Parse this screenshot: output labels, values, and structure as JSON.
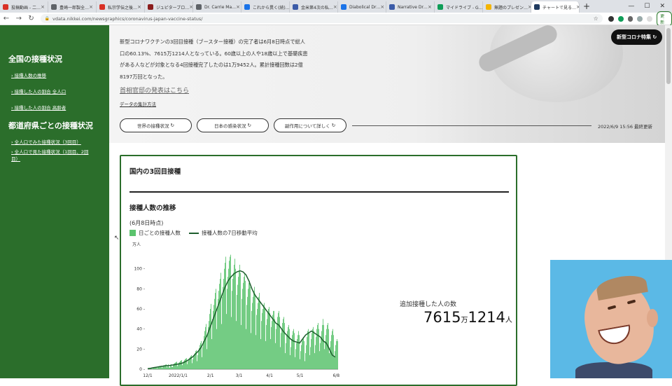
{
  "browser": {
    "tabs": [
      {
        "label": "投稿動画 - 二…",
        "color": "#d93025",
        "active": false
      },
      {
        "label": "豊崎一郎製全…",
        "color": "#5f6368",
        "active": false
      },
      {
        "label": "私宗学伝之後…",
        "color": "#d93025",
        "active": false
      },
      {
        "label": "ジュピターブロ…",
        "color": "#8a1c1c",
        "active": false
      },
      {
        "label": "Dr. Carrie Ma…",
        "color": "#5f6368",
        "active": false
      },
      {
        "label": "これから異く(続)…",
        "color": "#1a73e8",
        "active": false
      },
      {
        "label": "金米第4次の私…",
        "color": "#3b5ba8",
        "active": false
      },
      {
        "label": "Diabolical Dr…",
        "color": "#1a73e8",
        "active": false
      },
      {
        "label": "Narrative Dr…",
        "color": "#3b5ba8",
        "active": false
      },
      {
        "label": "マイドライブ - G…",
        "color": "#0f9d58",
        "active": false
      },
      {
        "label": "無題のプレゼン…",
        "color": "#f4b400",
        "active": false
      },
      {
        "label": "チャートで見る…",
        "color": "#1f3a5f",
        "active": true
      }
    ],
    "url": "vdata.nikkei.com/newsgraphics/coronavirus-japan-vaccine-status/",
    "update_label": "更新"
  },
  "sidebar": {
    "section1_title": "全国の接種状況",
    "section1_links": [
      "接種人数の推移",
      "接種した人の割合 全人口",
      "接種した人の割合 高齢者"
    ],
    "section2_title": "都道府県ごとの接種状況",
    "section2_links": [
      "全人口でみた接種状況（3回目）",
      "全人口で見た接種状況（1回目、2回目）"
    ]
  },
  "hero": {
    "intro": "新型コロナワクチンの3回目接種（ブースター接種）の完了者は6月8日時点で総人口の60.13%、7615万1214人となっている。60歳以上の人や18歳以上で基礎疾患がある人などが対象となる4回接種完了したのは1万9452人。累計接種回数は2億8197万回となった。",
    "kantei_link": "首相官邸の発表はこちら",
    "method_link": "データの集計方法",
    "buttons": [
      "世界の接種状況",
      "日本の感染状況",
      "副作用について詳しく"
    ],
    "updated": "2022/6/9 15:56 最終更新",
    "badge": "新型コロナ特集"
  },
  "card": {
    "title": "国内の3回目接種",
    "subtitle": "接種人数の推移",
    "as_of": "(6月8日時点)",
    "legend_daily": "日ごとの接種人数",
    "legend_avg": "接種人数の7日移動平均",
    "total_label": "追加接種した人の数",
    "total_big1": "7615",
    "total_unit1": "万",
    "total_big2": "1214",
    "total_unit2": "人"
  },
  "colors": {
    "sidebar_green": "#2b6e2b",
    "bar_green": "#5cc46e",
    "avg_line": "#1e5e2e"
  },
  "chart_data": {
    "type": "bar",
    "y_unit": "万人",
    "ylim": [
      0,
      120
    ],
    "yticks": [
      0,
      20,
      40,
      60,
      80,
      100
    ],
    "xticks": [
      "12/1",
      "2022/1/1",
      "2/1",
      "3/1",
      "4/1",
      "5/1",
      "6/8"
    ],
    "series": [
      {
        "name": "日ごとの接種人数",
        "type": "bar",
        "values": [
          0.3,
          0.5,
          0.8,
          0.6,
          1,
          1.2,
          0.4,
          1,
          1.5,
          1.8,
          1.6,
          2,
          2.2,
          0.8,
          2,
          2.5,
          3,
          2.8,
          3.2,
          3.5,
          1.2,
          3,
          3.6,
          4,
          3.8,
          4.5,
          4.8,
          1.8,
          4,
          5,
          2,
          1.5,
          4,
          5,
          2.5,
          2.2,
          4.5,
          5.5,
          6,
          6.5,
          7,
          7.5,
          3,
          5,
          6.5,
          7,
          8,
          8.5,
          9,
          4,
          6.5,
          8,
          9,
          10,
          10.5,
          11,
          5,
          8,
          10,
          11,
          12,
          13,
          14,
          6,
          10,
          13,
          15,
          16,
          18,
          19,
          8,
          14,
          18,
          21,
          24,
          26,
          28,
          12,
          22,
          28,
          33,
          38,
          42,
          45,
          20,
          35,
          42,
          48,
          55,
          60,
          65,
          30,
          50,
          58,
          64,
          70,
          76,
          80,
          40,
          62,
          70,
          78,
          85,
          90,
          96,
          45,
          72,
          82,
          90,
          100,
          106,
          112,
          55,
          80,
          92,
          100,
          108,
          112,
          114,
          52,
          78,
          90,
          96,
          104,
          110,
          100,
          48,
          74,
          84,
          92,
          98,
          104,
          96,
          44,
          70,
          80,
          86,
          92,
          96,
          88,
          40,
          64,
          72,
          80,
          86,
          88,
          82,
          36,
          58,
          66,
          72,
          78,
          82,
          75,
          34,
          54,
          60,
          66,
          72,
          76,
          68,
          30,
          48,
          56,
          60,
          64,
          66,
          60,
          28,
          44,
          50,
          56,
          60,
          62,
          56,
          30,
          42,
          48,
          54,
          58,
          58,
          50,
          26,
          40,
          46,
          52,
          56,
          58,
          52,
          22,
          36,
          40,
          46,
          50,
          52,
          46,
          16,
          26,
          34,
          38,
          42,
          44,
          40,
          14,
          22,
          30,
          34,
          38,
          40,
          36,
          12,
          20,
          26,
          30,
          34,
          38,
          34,
          10,
          18,
          24,
          28,
          30,
          32,
          28,
          8,
          16,
          24,
          32,
          38,
          40,
          36,
          14,
          22,
          30,
          36,
          40,
          42,
          38,
          16,
          24,
          32,
          40,
          44,
          46,
          40,
          18,
          26,
          32,
          38,
          44,
          50,
          44,
          20,
          28,
          34,
          40,
          44,
          46,
          40,
          16,
          22,
          28,
          34,
          38,
          40,
          34,
          12,
          18,
          24,
          28,
          30,
          28
        ]
      },
      {
        "name": "接種人数の7日移動平均",
        "type": "line",
        "values": [
          0.5,
          1,
          1.5,
          2,
          2.5,
          3,
          3.5,
          3.5,
          4,
          4.5,
          5,
          5.5,
          6.5,
          8,
          10,
          12,
          15,
          18,
          22,
          28,
          34,
          42,
          50,
          58,
          66,
          74,
          82,
          88,
          92,
          95,
          97,
          98,
          97,
          94,
          88,
          80,
          74,
          70,
          66,
          62,
          58,
          54,
          50,
          46,
          44,
          40,
          36,
          33,
          30,
          28,
          27,
          26,
          30,
          34,
          36,
          38,
          36,
          34,
          32,
          28,
          26,
          20,
          14,
          12
        ]
      }
    ]
  }
}
